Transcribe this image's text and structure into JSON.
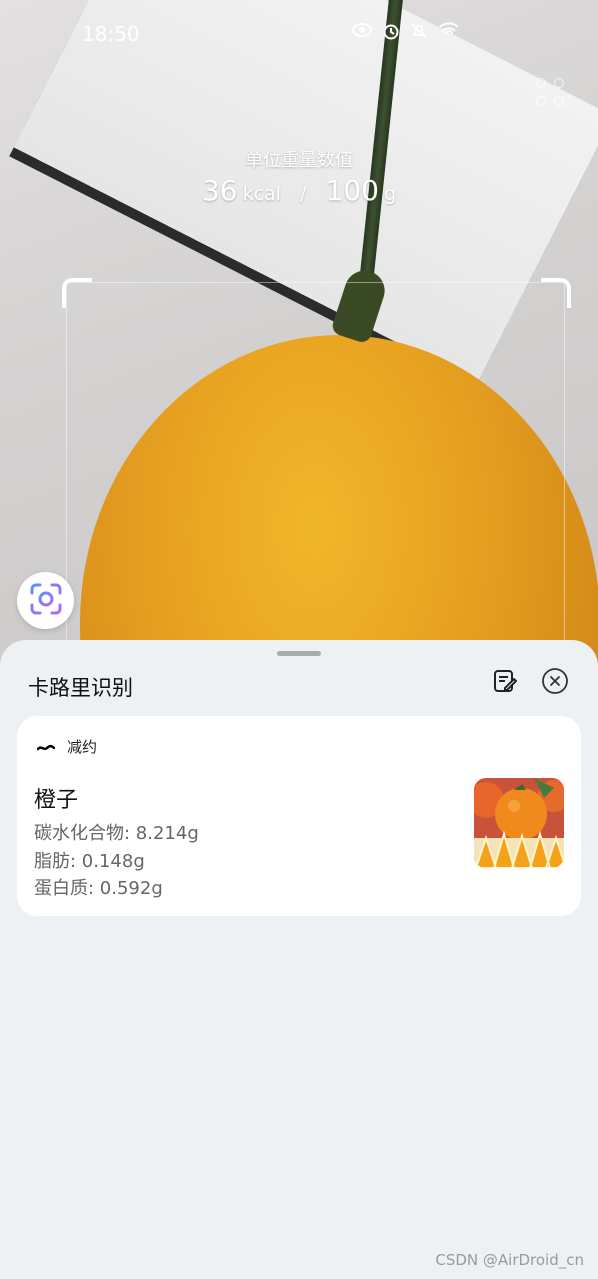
{
  "status_bar": {
    "time": "18:50",
    "icons": [
      "eye-icon",
      "alarm-icon",
      "mute-icon",
      "wifi-icon"
    ]
  },
  "camera": {
    "unit_title": "单位重量数值",
    "calories_value": "36",
    "calories_unit": "kcal",
    "separator": "/",
    "weight_value": "100",
    "weight_unit": "g"
  },
  "sheet": {
    "title": "卡路里识别",
    "edit_icon": "edit-note-icon",
    "close_icon": "close-circle-icon"
  },
  "result": {
    "brand": "减约",
    "food_name": "橙子",
    "nutrients": [
      "碳水化合物: 8.214g",
      "脂肪: 0.148g",
      "蛋白质: 0.592g"
    ]
  },
  "watermark": "CSDN @AirDroid_cn",
  "colors": {
    "sheet_bg": "#eef1f4",
    "card_bg": "#ffffff",
    "orange": "#e8a321"
  }
}
